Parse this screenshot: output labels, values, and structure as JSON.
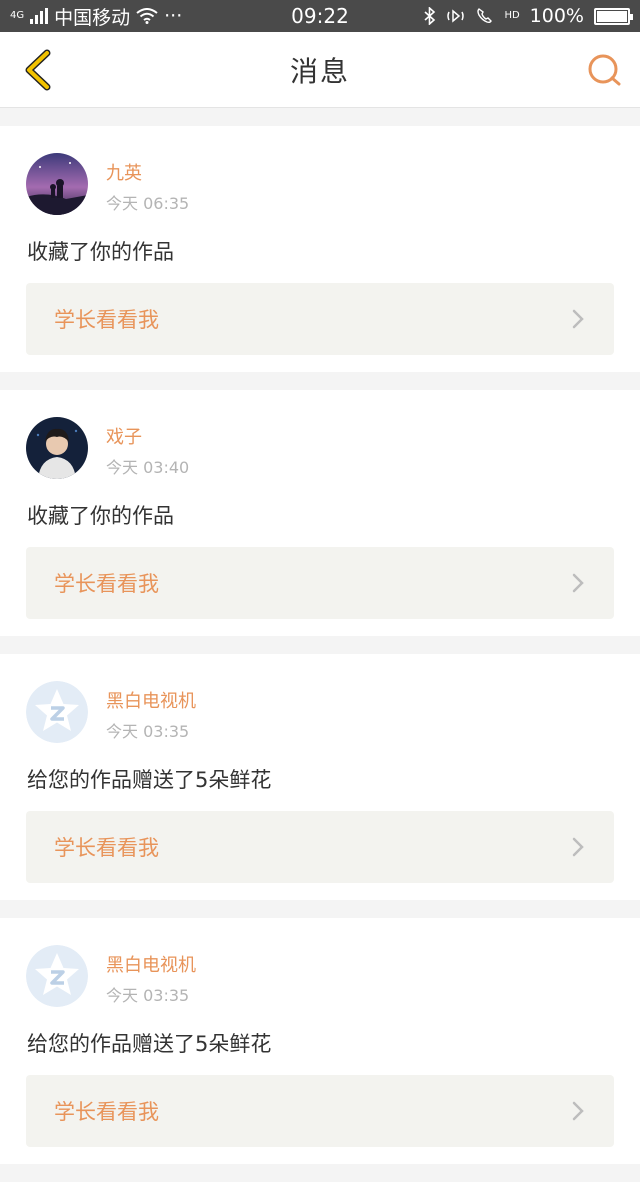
{
  "status_bar": {
    "network": "4G",
    "carrier": "中国移动",
    "more": "···",
    "time": "09:22",
    "hd": "HD",
    "battery": "100%",
    "battery_level": 1.0
  },
  "header": {
    "title": "消息"
  },
  "messages": [
    {
      "name": "九英",
      "time": "今天 06:35",
      "text": "收藏了你的作品",
      "work_title": "学长看看我",
      "avatar": "photo-purple-sky"
    },
    {
      "name": "戏子",
      "time": "今天 03:40",
      "text": "收藏了你的作品",
      "work_title": "学长看看我",
      "avatar": "photo-person-dark"
    },
    {
      "name": "黑白电视机",
      "time": "今天 03:35",
      "text": "给您的作品赠送了5朵鲜花",
      "work_title": "学长看看我",
      "avatar": "default-qzone-star-icon"
    },
    {
      "name": "黑白电视机",
      "time": "今天 03:35",
      "text": "给您的作品赠送了5朵鲜花",
      "work_title": "学长看看我",
      "avatar": "default-qzone-star-icon"
    }
  ],
  "colors": {
    "accent": "#e8945a",
    "back_arrow": "#f2c200",
    "status_bar": "#4a4a4a",
    "card_link_bg": "#f3f3ef"
  }
}
